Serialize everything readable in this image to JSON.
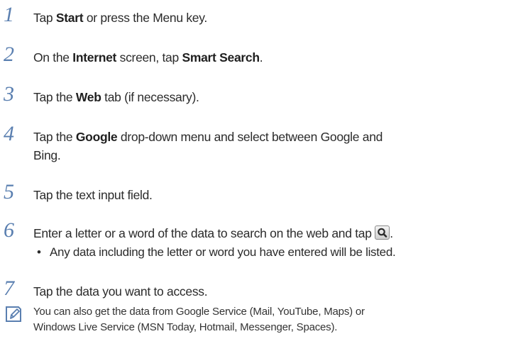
{
  "steps": [
    {
      "num": "1",
      "parts": [
        "Tap ",
        "Start",
        " or press the Menu key."
      ]
    },
    {
      "num": "2",
      "parts": [
        "On the ",
        "Internet",
        " screen, tap ",
        "Smart Search",
        "."
      ]
    },
    {
      "num": "3",
      "parts": [
        "Tap the ",
        "Web",
        " tab (if necessary)."
      ]
    },
    {
      "num": "4",
      "parts": [
        "Tap the ",
        "Google",
        " drop-down menu and select between Google and",
        "Bing."
      ]
    },
    {
      "num": "5",
      "parts": [
        "Tap the text input field."
      ]
    },
    {
      "num": "6",
      "parts": [
        "Enter a letter or a word of the data to search on the web and tap ",
        "."
      ]
    },
    {
      "num": "7",
      "parts": [
        "Tap the data you want to access."
      ]
    }
  ],
  "bullet": {
    "mark": "•",
    "text": "Any data including the letter or word you have entered will be listed."
  },
  "note": {
    "line1": "You can also get the data from Google Service (Mail, YouTube, Maps) or",
    "line2": "Windows Live Service (MSN Today, Hotmail, Messenger, Spaces)."
  },
  "icons": {
    "inline_button": "search-icon",
    "note": "note-pencil-icon"
  }
}
